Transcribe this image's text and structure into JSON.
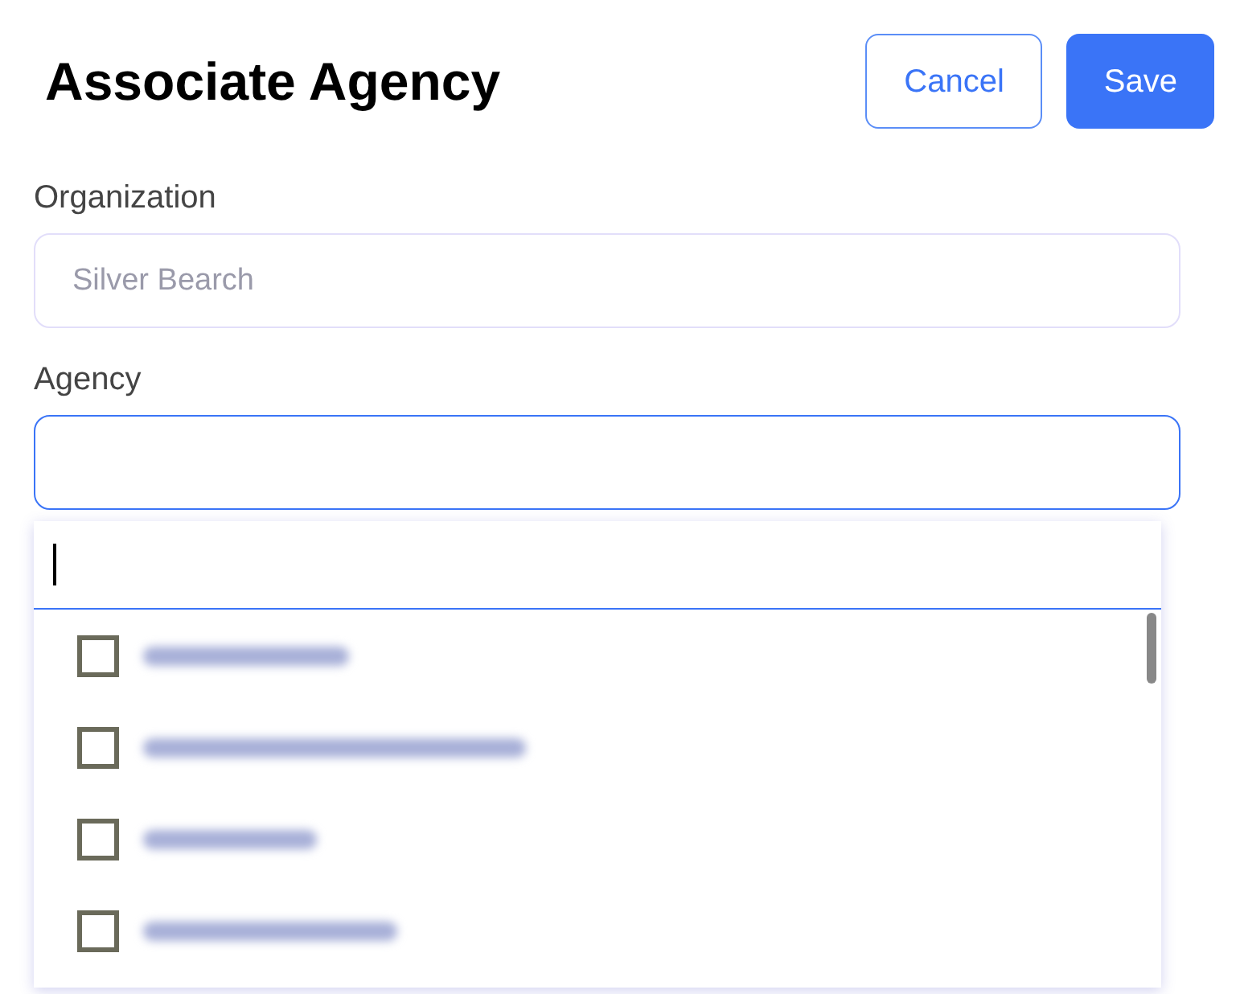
{
  "title": "Associate Agency",
  "buttons": [
    {
      "label": "Cancel",
      "kind": "secondary"
    },
    {
      "label": "Save",
      "kind": "primary"
    }
  ],
  "organization": {
    "label": "Organization",
    "value": "Silver Bearch",
    "disabled": true
  },
  "agency": {
    "label": "Agency",
    "focused": true
  },
  "dropdown": {
    "items": [
      {
        "checked": false
      },
      {
        "checked": false
      },
      {
        "checked": false
      },
      {
        "checked": false
      }
    ]
  }
}
